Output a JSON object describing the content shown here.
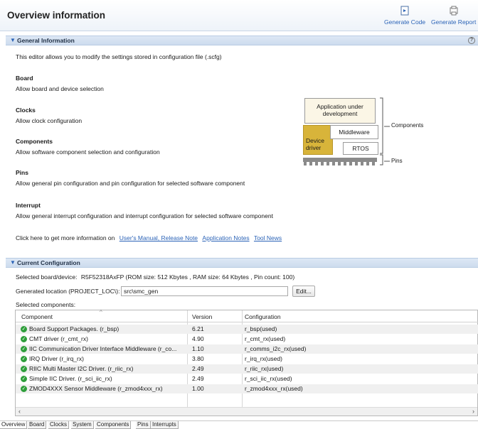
{
  "header": {
    "title": "Overview information",
    "generate_code_label": "Generate Code",
    "generate_report_label": "Generate Report"
  },
  "general": {
    "section_title": "General Information",
    "intro": "This editor allows you to modify the settings stored in configuration file (.scfg)",
    "items": [
      {
        "title": "Board",
        "desc": "Allow board and device selection"
      },
      {
        "title": "Clocks",
        "desc": "Allow clock configuration"
      },
      {
        "title": "Components",
        "desc": "Allow software component selection and configuration"
      },
      {
        "title": "Pins",
        "desc": "Allow general pin configuration and pin configuration for selected software component"
      },
      {
        "title": "Interrupt",
        "desc": "Allow general interrupt configuration and interrupt configuration for selected software component"
      }
    ],
    "more_info_text": "Click here to get more information on",
    "links": [
      "User's Manual, Release Note",
      "Application Notes",
      "Tool News"
    ],
    "diagram": {
      "app_label": "Application under development",
      "middleware_label": "Middleware",
      "device_driver_label": "Device driver",
      "rtos_label": "RTOS",
      "components_label": "Components",
      "pins_label": "Pins"
    }
  },
  "current": {
    "section_title": "Current Configuration",
    "board_label": "Selected board/device:",
    "board_value": "R5F52318AxFP (ROM size: 512 Kbytes , RAM size: 64 Kbytes , Pin count: 100)",
    "location_label": "Generated location (PROJECT_LOC\\):",
    "location_value": "src\\smc_gen",
    "edit_label": "Edit...",
    "components_label": "Selected components:",
    "columns": [
      "Component",
      "Version",
      "Configuration"
    ],
    "rows": [
      {
        "component": "Board Support Packages. (r_bsp)",
        "version": "6.21",
        "configuration": "r_bsp(used)"
      },
      {
        "component": "CMT driver (r_cmt_rx)",
        "version": "4.90",
        "configuration": "r_cmt_rx(used)"
      },
      {
        "component": "IIC Communication Driver Interface Middleware (r_co...",
        "version": "1.10",
        "configuration": "r_comms_i2c_rx(used)"
      },
      {
        "component": "IRQ Driver (r_irq_rx)",
        "version": "3.80",
        "configuration": "r_irq_rx(used)"
      },
      {
        "component": "RIIC Multi Master I2C Driver. (r_riic_rx)",
        "version": "2.49",
        "configuration": "r_riic_rx(used)"
      },
      {
        "component": "Simple IIC Driver. (r_sci_iic_rx)",
        "version": "2.49",
        "configuration": "r_sci_iic_rx(used)"
      },
      {
        "component": "ZMOD4XXX Sensor Middleware (r_zmod4xxx_rx)",
        "version": "1.00",
        "configuration": "r_zmod4xxx_rx(used)"
      }
    ]
  },
  "tabs": [
    "Overview",
    "Board",
    "Clocks",
    "System",
    "Components",
    "Pins",
    "Interrupts"
  ],
  "icons": {
    "generate_code": "generate-code-icon",
    "generate_report": "generate-report-icon",
    "help": "help-icon",
    "status_ok": "check-circle-icon"
  },
  "colors": {
    "accent": "#2b63b7",
    "section_bar": "#d4e1f1",
    "driver_box": "#d8b43a",
    "ok_green": "#2e9e3a"
  }
}
